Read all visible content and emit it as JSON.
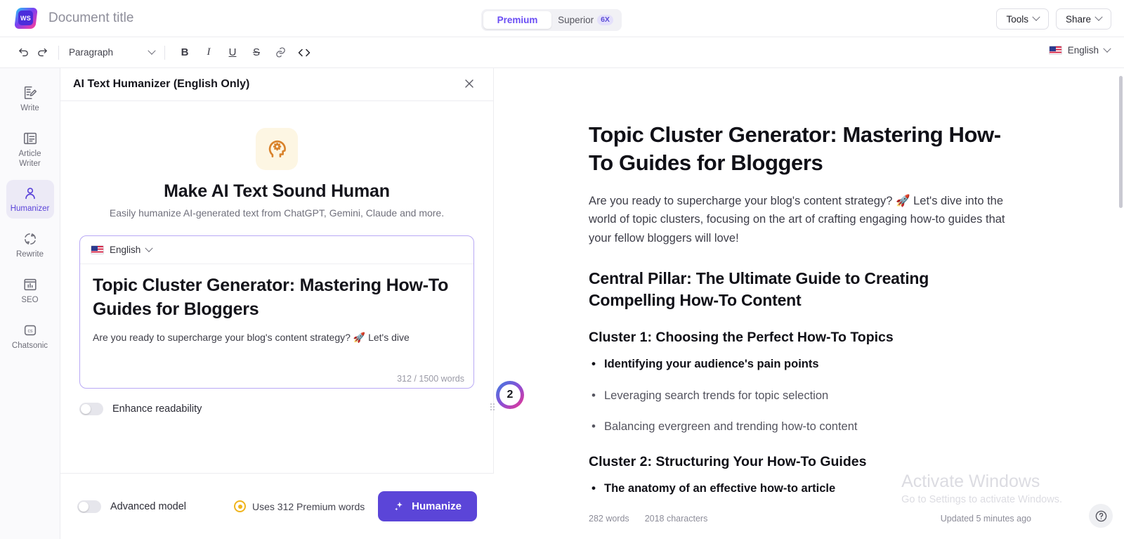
{
  "header": {
    "logo_text": "WS",
    "document_title": "Document title",
    "mode_tabs": [
      {
        "label": "Premium",
        "badge": "",
        "active": true
      },
      {
        "label": "Superior",
        "badge": "6X",
        "active": false
      }
    ],
    "tools_label": "Tools",
    "share_label": "Share"
  },
  "toolbar": {
    "paragraph_label": "Paragraph",
    "bold_label": "B",
    "italic_label": "I",
    "underline_label": "U",
    "strike_label": "S",
    "language_label": "English"
  },
  "sidebar": {
    "items": [
      {
        "label": "Write",
        "icon": "document-edit-icon",
        "active": false
      },
      {
        "label": "Article Writer",
        "icon": "article-icon",
        "active": false
      },
      {
        "label": "Humanizer",
        "icon": "person-icon",
        "active": true
      },
      {
        "label": "Rewrite",
        "icon": "refresh-icon",
        "active": false
      },
      {
        "label": "SEO",
        "icon": "chart-window-icon",
        "active": false
      },
      {
        "label": "Chatsonic",
        "icon": "cs-icon",
        "active": false
      }
    ]
  },
  "panel": {
    "title": "AI Text Humanizer (English Only)",
    "hero_heading": "Make AI Text Sound Human",
    "hero_sub": "Easily humanize AI-generated text from ChatGPT, Gemini, Claude and more.",
    "input_language": "English",
    "input_text": "Topic Cluster Generator: Mastering How-To Guides for Bloggers",
    "input_body": "Are you ready to supercharge your blog's content strategy? 🚀 Let's dive",
    "word_count": "312 / 1500 words",
    "enhance_readability_label": "Enhance readability",
    "enhance_readability_on": false,
    "advanced_model_label": "Advanced model",
    "advanced_model_on": false,
    "uses_label": "Uses 312 Premium words",
    "humanize_label": "Humanize"
  },
  "document": {
    "h1": "Topic Cluster Generator: Mastering How-To Guides for Bloggers",
    "intro": "Are you ready to supercharge your blog's content strategy? 🚀 Let's dive into the world of topic clusters, focusing on the art of crafting engaging how-to guides that your fellow bloggers will love!",
    "h2": "Central Pillar: The Ultimate Guide to Creating Compelling How-To Content",
    "cluster1_heading": "Cluster 1: Choosing the Perfect How-To Topics",
    "cluster1_items": [
      "Identifying your audience's pain points",
      "Leveraging search trends for topic selection",
      "Balancing evergreen and trending how-to content"
    ],
    "cluster2_heading": "Cluster 2: Structuring Your How-To Guides",
    "cluster2_items": [
      "The anatomy of an effective how-to article"
    ],
    "words_stat": "282 words",
    "characters_stat": "2018 characters",
    "updated_stat": "Updated 5 minutes ago"
  },
  "annotation": {
    "marker_number": "2"
  },
  "watermark": {
    "line1": "Activate Windows",
    "line2": "Go to Settings to activate Windows."
  },
  "help": {
    "label": "?"
  },
  "colors": {
    "accent_purple": "#5b45d8",
    "active_nav": "#5b44d9",
    "coin_gold": "#f0b41c",
    "input_border": "#b9a9f5"
  }
}
